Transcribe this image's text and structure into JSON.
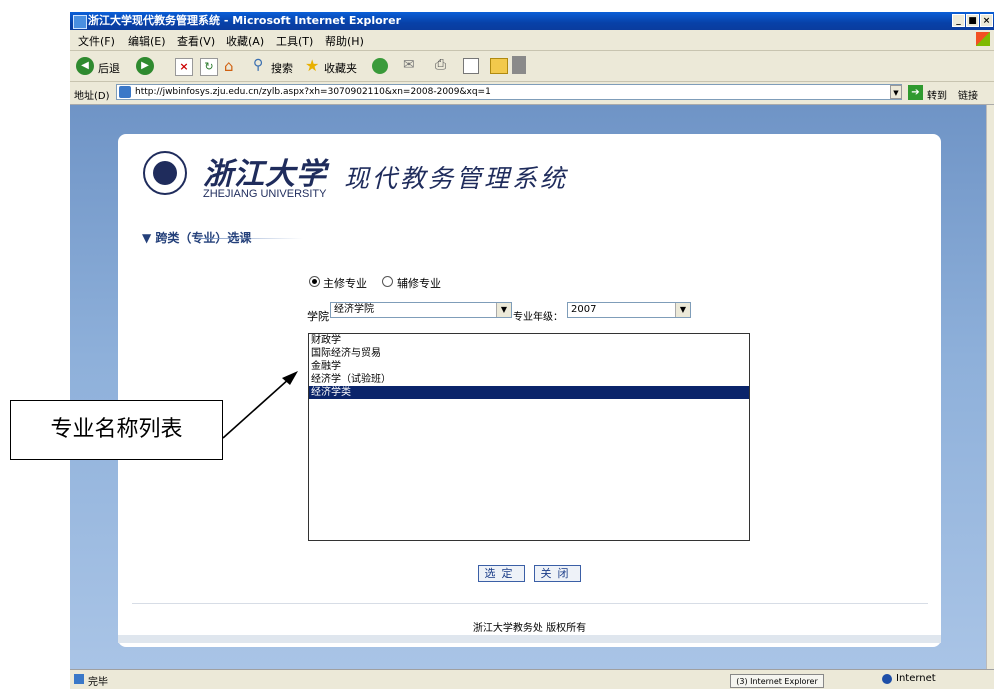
{
  "window": {
    "title": "浙江大学现代教务管理系统 - Microsoft Internet Explorer",
    "controls": [
      "_",
      "■",
      "×"
    ]
  },
  "menubar": [
    "文件(F)",
    "编辑(E)",
    "查看(V)",
    "收藏(A)",
    "工具(T)",
    "帮助(H)"
  ],
  "toolbar": {
    "back": "后退",
    "search": "搜索",
    "favorites": "收藏夹"
  },
  "addressbar": {
    "label": "地址(D)",
    "url": "http://jwbinfosys.zju.edu.cn/zylb.aspx?xh=3070902110&xn=2008-2009&xq=1",
    "go": "转到",
    "links": "链接"
  },
  "header": {
    "logo_cn": "浙江大学",
    "logo_en": "ZHEJIANG UNIVERSITY",
    "system_name": "现代教务管理系统"
  },
  "section": {
    "title": "跨类（专业）选课",
    "marker": "▼"
  },
  "major_type": {
    "options": [
      "主修专业",
      "辅修专业"
    ],
    "selected": "主修专业"
  },
  "filters": {
    "college_label": "学院",
    "college_value": "经济学院",
    "grade_label": "专业年级：",
    "grade_value": "2007"
  },
  "major_list": {
    "items": [
      "财政学",
      "国际经济与贸易",
      "金融学",
      "经济学（试验班）",
      "经济学类"
    ],
    "selected": "经济学类"
  },
  "buttons": {
    "confirm": "选定",
    "close": "关闭"
  },
  "footer": "浙江大学教务处 版权所有",
  "statusbar": {
    "status": "完毕",
    "taskbar": "(3) Internet Explorer",
    "zone": "Internet"
  },
  "annotation": "专业名称列表"
}
